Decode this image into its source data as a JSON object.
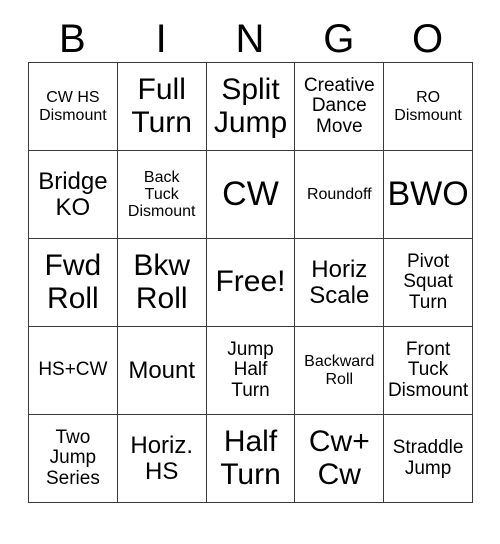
{
  "card": {
    "headers": [
      "B",
      "I",
      "N",
      "G",
      "O"
    ],
    "rows": [
      [
        {
          "text": "CW HS\nDismount",
          "size": "fs-s"
        },
        {
          "text": "Full\nTurn",
          "size": "fs-xl"
        },
        {
          "text": "Split\nJump",
          "size": "fs-xl"
        },
        {
          "text": "Creative\nDance\nMove",
          "size": "fs-m"
        },
        {
          "text": "RO\nDismount",
          "size": "fs-s"
        }
      ],
      [
        {
          "text": "Bridge\nKO",
          "size": "fs-l"
        },
        {
          "text": "Back\nTuck\nDismount",
          "size": "fs-s"
        },
        {
          "text": "CW",
          "size": "fs-xxl"
        },
        {
          "text": "Roundoff",
          "size": "fs-s"
        },
        {
          "text": "BWO",
          "size": "fs-xxl"
        }
      ],
      [
        {
          "text": "Fwd\nRoll",
          "size": "fs-xl"
        },
        {
          "text": "Bkw\nRoll",
          "size": "fs-xl"
        },
        {
          "text": "Free!",
          "size": "fs-xl"
        },
        {
          "text": "Horiz\nScale",
          "size": "fs-l"
        },
        {
          "text": "Pivot\nSquat\nTurn",
          "size": "fs-m"
        }
      ],
      [
        {
          "text": "HS+CW",
          "size": "fs-m"
        },
        {
          "text": "Mount",
          "size": "fs-l"
        },
        {
          "text": "Jump\nHalf\nTurn",
          "size": "fs-m"
        },
        {
          "text": "Backward\nRoll",
          "size": "fs-s"
        },
        {
          "text": "Front\nTuck\nDismount",
          "size": "fs-m"
        }
      ],
      [
        {
          "text": "Two\nJump\nSeries",
          "size": "fs-m"
        },
        {
          "text": "Horiz.\nHS",
          "size": "fs-l"
        },
        {
          "text": "Half\nTurn",
          "size": "fs-xl"
        },
        {
          "text": "Cw+\nCw",
          "size": "fs-xl"
        },
        {
          "text": "Straddle\nJump",
          "size": "fs-m"
        }
      ]
    ],
    "free_space": {
      "row": 2,
      "column": 2,
      "label": "Free!"
    },
    "colors": {
      "background": "#ffffff",
      "text": "#000000",
      "grid_line": "#3a3a3a"
    }
  }
}
